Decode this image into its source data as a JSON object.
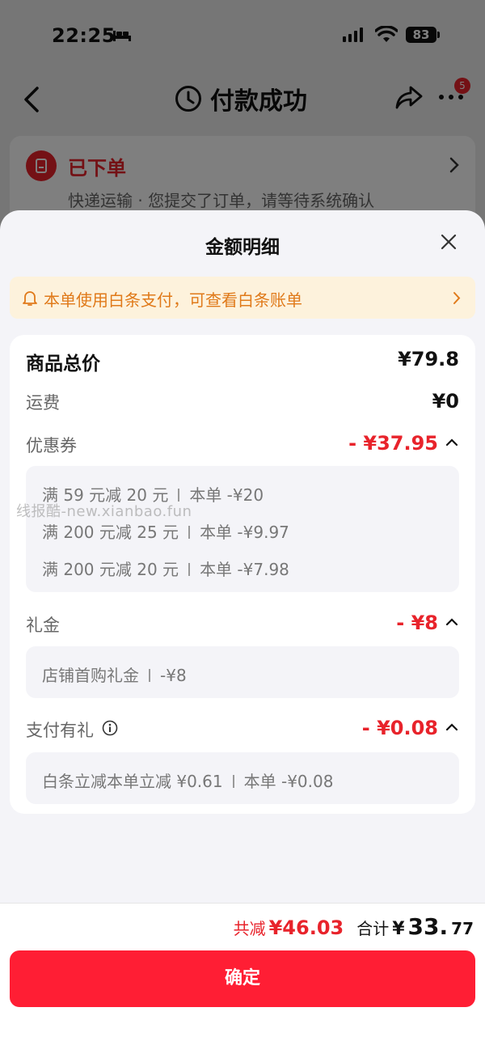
{
  "status_bar": {
    "time": "22:25",
    "battery": "83"
  },
  "nav": {
    "title": "付款成功",
    "badge": "5"
  },
  "order": {
    "status": "已下单",
    "description": "快递运输 · 您提交了订单，请等待系统确认"
  },
  "sheet": {
    "title": "金额明细",
    "notice": "本单使用白条支付，可查看白条账单",
    "goods_total": {
      "label": "商品总价",
      "value": "¥79.8"
    },
    "shipping": {
      "label": "运费",
      "value": "¥0"
    },
    "coupon": {
      "label": "优惠券",
      "value": "- ¥37.95",
      "items": [
        {
          "name": "满 59 元减 20 元",
          "amount": "本单 -¥20"
        },
        {
          "name": "满 200 元减 25 元",
          "amount": "本单 -¥9.97"
        },
        {
          "name": "满 200 元减 20 元",
          "amount": "本单 -¥7.98"
        }
      ]
    },
    "gift": {
      "label": "礼金",
      "value": "- ¥8",
      "items": [
        {
          "name": "店铺首购礼金",
          "amount": "-¥8"
        }
      ]
    },
    "pay_gift": {
      "label": "支付有礼",
      "value": "- ¥0.08",
      "items": [
        {
          "name": "白条立减本单立减 ¥0.61",
          "amount": "本单 -¥0.08"
        }
      ]
    }
  },
  "watermark": "线报酷-new.xianbao.fun",
  "footer": {
    "save_label": "共减",
    "save_amount": "¥46.03",
    "total_label": "合计",
    "total_currency": "¥",
    "total_int": "33.",
    "total_dec": "77",
    "confirm": "确定"
  },
  "colors": {
    "accent_red": "#e8232b",
    "button_red": "#ff1e34",
    "notice_bg": "#fdf2dc",
    "notice_text": "#e07a1a"
  }
}
